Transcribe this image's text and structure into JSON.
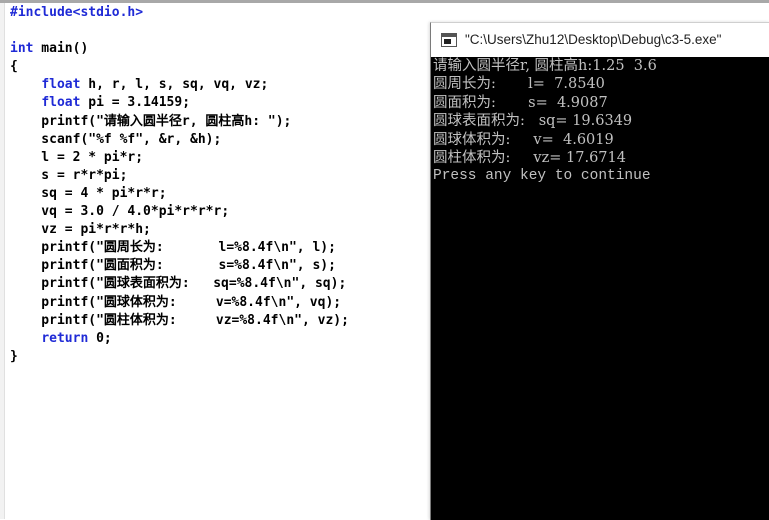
{
  "editor": {
    "lines": [
      {
        "parts": [
          {
            "t": "#include<stdio.h>",
            "c": "pp"
          }
        ]
      },
      {
        "parts": [
          {
            "t": "",
            "c": ""
          }
        ]
      },
      {
        "parts": [
          {
            "t": "int",
            "c": "kw"
          },
          {
            "t": " main()",
            "c": ""
          }
        ]
      },
      {
        "parts": [
          {
            "t": "{",
            "c": ""
          }
        ]
      },
      {
        "parts": [
          {
            "t": "    ",
            "c": ""
          },
          {
            "t": "float",
            "c": "kw"
          },
          {
            "t": " h, r, l, s, sq, vq, vz;",
            "c": ""
          }
        ]
      },
      {
        "parts": [
          {
            "t": "    ",
            "c": ""
          },
          {
            "t": "float",
            "c": "kw"
          },
          {
            "t": " pi = 3.14159;",
            "c": ""
          }
        ]
      },
      {
        "parts": [
          {
            "t": "    printf(\"请输入圆半径r, 圆柱高h: \");",
            "c": ""
          }
        ]
      },
      {
        "parts": [
          {
            "t": "    scanf(\"%f %f\", &r, &h);",
            "c": ""
          }
        ]
      },
      {
        "parts": [
          {
            "t": "    l = 2 * pi*r;",
            "c": ""
          }
        ]
      },
      {
        "parts": [
          {
            "t": "    s = r*r*pi;",
            "c": ""
          }
        ]
      },
      {
        "parts": [
          {
            "t": "    sq = 4 * pi*r*r;",
            "c": ""
          }
        ]
      },
      {
        "parts": [
          {
            "t": "    vq = 3.0 / 4.0*pi*r*r*r;",
            "c": ""
          }
        ]
      },
      {
        "parts": [
          {
            "t": "    vz = pi*r*r*h;",
            "c": ""
          }
        ]
      },
      {
        "parts": [
          {
            "t": "    printf(\"圆周长为:       l=%8.4f\\n\", l);",
            "c": ""
          }
        ]
      },
      {
        "parts": [
          {
            "t": "    printf(\"圆面积为:       s=%8.4f\\n\", s);",
            "c": ""
          }
        ]
      },
      {
        "parts": [
          {
            "t": "    printf(\"圆球表面积为:   sq=%8.4f\\n\", sq);",
            "c": ""
          }
        ]
      },
      {
        "parts": [
          {
            "t": "    printf(\"圆球体积为:     v=%8.4f\\n\", vq);",
            "c": ""
          }
        ]
      },
      {
        "parts": [
          {
            "t": "    printf(\"圆柱体积为:     vz=%8.4f\\n\", vz);",
            "c": ""
          }
        ]
      },
      {
        "parts": [
          {
            "t": "    ",
            "c": ""
          },
          {
            "t": "return",
            "c": "kw"
          },
          {
            "t": " 0;",
            "c": ""
          }
        ]
      },
      {
        "parts": [
          {
            "t": "}",
            "c": ""
          }
        ]
      }
    ]
  },
  "console": {
    "title": "\"C:\\Users\\Zhu12\\Desktop\\Debug\\c3-5.exe\"",
    "output": [
      "请输入圆半径r, 圆柱高h:1.25  3.6",
      "圆周长为:       l=  7.8540",
      "圆面积为:       s=  4.9087",
      "圆球表面积为:   sq= 19.6349",
      "圆球体积为:     v=  4.6019",
      "圆柱体积为:     vz= 17.6714",
      "Press any key to continue"
    ]
  },
  "colors": {
    "keyword": "#1f2ad6",
    "console_bg": "#000000",
    "console_text": "#c0c0c0"
  },
  "icons": {
    "console_window_icon": "cmd-icon"
  }
}
